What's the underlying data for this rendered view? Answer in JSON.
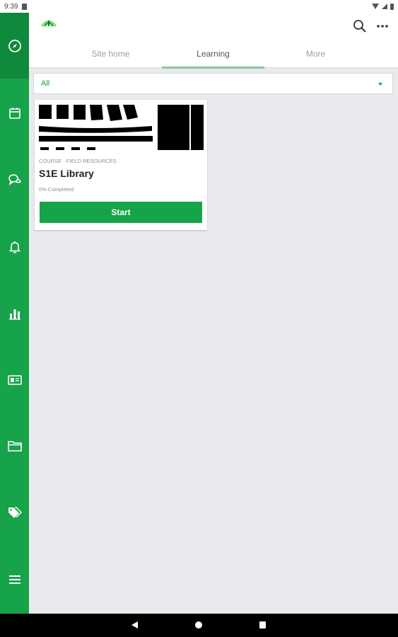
{
  "status_bar": {
    "time": "9:39"
  },
  "header": {
    "search_icon": "search-icon",
    "more_icon": "more-options-icon"
  },
  "tabs": [
    {
      "label": "Site home",
      "active": false
    },
    {
      "label": "Learning",
      "active": true
    },
    {
      "label": "More",
      "active": false
    }
  ],
  "filter": {
    "value": "All"
  },
  "sidebar": {
    "items": [
      {
        "icon": "compass-icon",
        "active": true
      },
      {
        "icon": "calendar-icon"
      },
      {
        "icon": "chat-icon"
      },
      {
        "icon": "bell-icon"
      },
      {
        "icon": "bar-chart-icon"
      },
      {
        "icon": "id-card-icon"
      },
      {
        "icon": "folder-icon"
      },
      {
        "icon": "tags-icon"
      },
      {
        "icon": "menu-icon"
      }
    ]
  },
  "course_card": {
    "meta": "COURSE · FIELD RESOURCES",
    "title": "S1E Library",
    "progress": "0% Completed",
    "button_label": "Start"
  },
  "colors": {
    "brand_green": "#17a34a",
    "sidebar_active": "#0f8a3c",
    "background": "#e8eaed"
  }
}
